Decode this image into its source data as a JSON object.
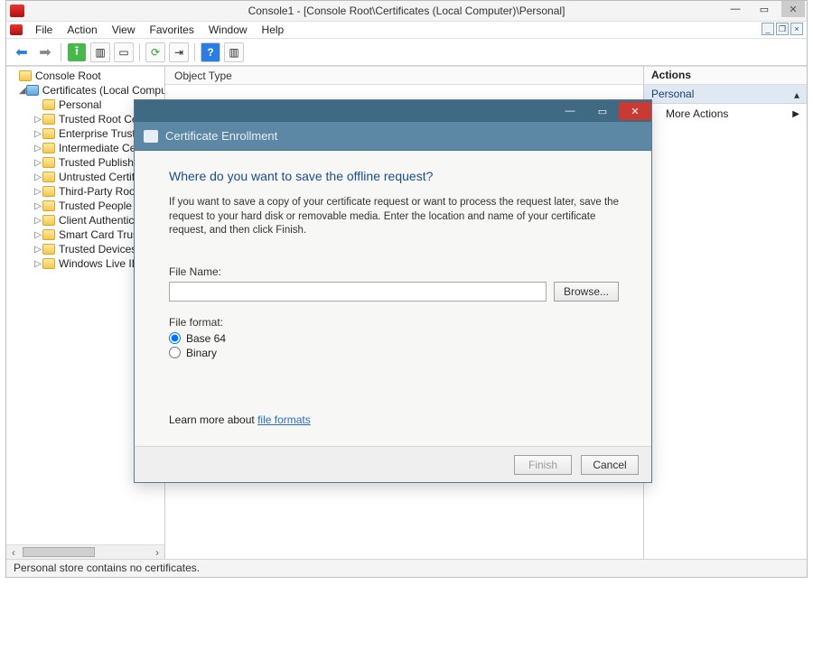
{
  "mmc": {
    "title": "Console1 - [Console Root\\Certificates (Local Computer)\\Personal]",
    "menus": [
      "File",
      "Action",
      "View",
      "Favorites",
      "Window",
      "Help"
    ],
    "status": "Personal store contains no certificates."
  },
  "tree": {
    "root": "Console Root",
    "certs": "Certificates (Local Compute",
    "items": [
      "Personal",
      "Trusted Root Ce",
      "Enterprise Trust",
      "Intermediate Cer",
      "Trusted Publishe",
      "Untrusted Certifi",
      "Third-Party Root",
      "Trusted People",
      "Client Authentic",
      "Smart Card Trust",
      "Trusted Devices",
      "Windows Live ID"
    ]
  },
  "list": {
    "col0": "Object Type"
  },
  "actions": {
    "title": "Actions",
    "section": "Personal",
    "more": "More Actions"
  },
  "dialog": {
    "header": "Certificate Enrollment",
    "question": "Where do you want to save the offline request?",
    "description": "If you want to save a copy of your certificate request or want to process the request later, save the request to your hard disk or removable media. Enter the location and name of your certificate request, and then click Finish.",
    "filename_label": "File Name:",
    "filename_value": "",
    "browse": "Browse...",
    "fileformat_label": "File format:",
    "radios": {
      "base64": "Base 64",
      "binary": "Binary"
    },
    "selected_format": "base64",
    "learn_prefix": "Learn more about ",
    "learn_link": "file formats",
    "finish": "Finish",
    "cancel": "Cancel"
  }
}
